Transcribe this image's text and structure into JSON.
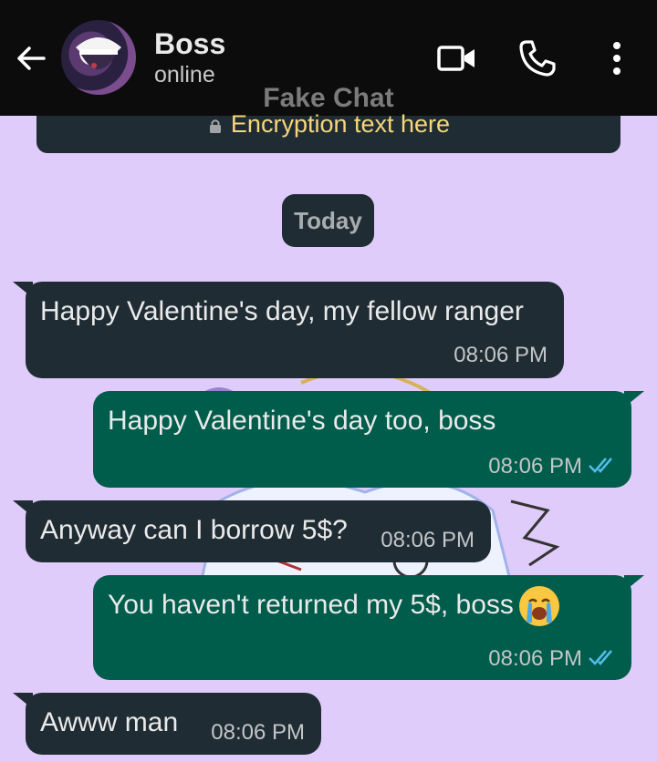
{
  "header": {
    "contact_name": "Boss",
    "contact_status": "online",
    "watermark": "Fake Chat",
    "encryption_text": "Encryption text here",
    "icons": [
      "back-arrow-icon",
      "video-call-icon",
      "voice-call-icon",
      "more-options-icon"
    ]
  },
  "date_badge": "Today",
  "colors": {
    "chat_background": "#e0ccfa",
    "incoming_bubble": "#202c33",
    "outgoing_bubble": "#005c4b",
    "read_ticks": "#53bdeb",
    "encryption_text": "#f7d57c"
  },
  "messages": [
    {
      "direction": "incoming",
      "text": "Happy Valentine's day, my fellow ranger",
      "time": "08:06 PM"
    },
    {
      "direction": "outgoing",
      "text": "Happy Valentine's day too, boss",
      "time": "08:06 PM",
      "status": "read"
    },
    {
      "direction": "incoming",
      "text": "Anyway can I borrow 5$?",
      "time": "08:06 PM"
    },
    {
      "direction": "outgoing",
      "text": "You haven't returned my 5$, boss",
      "emoji": "loudly-crying-face",
      "time": "08:06 PM",
      "status": "read"
    },
    {
      "direction": "incoming",
      "text": "Awww man",
      "time": "08:06 PM"
    }
  ]
}
